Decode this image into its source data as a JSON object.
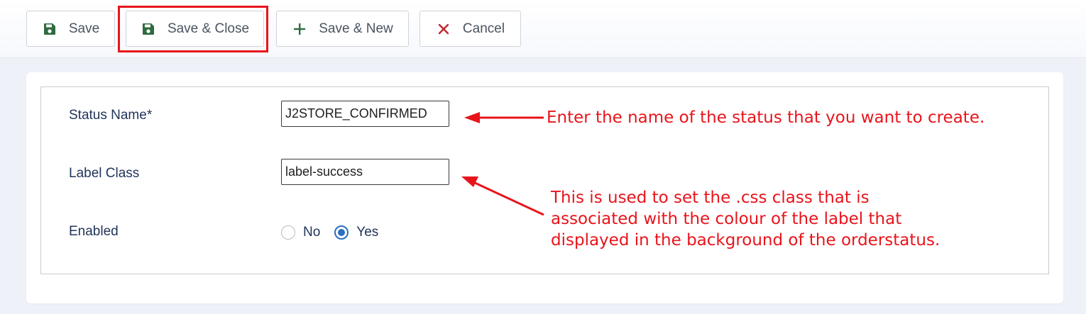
{
  "toolbar": {
    "save_label": "Save",
    "save_close_label": "Save & Close",
    "save_new_label": "Save & New",
    "cancel_label": "Cancel"
  },
  "form": {
    "status_name": {
      "label": "Status Name*",
      "value": "J2STORE_CONFIRMED"
    },
    "label_class": {
      "label": "Label Class",
      "value": "label-success"
    },
    "enabled": {
      "label": "Enabled",
      "options": [
        {
          "label": "No",
          "selected": false
        },
        {
          "label": "Yes",
          "selected": true
        }
      ]
    }
  },
  "annotations": {
    "status_name": "Enter the name of the status that you want to create.",
    "label_class": [
      "This is used to set the .css class that is",
      "associated with the colour of the label that",
      "displayed in the background of the orderstatus."
    ]
  },
  "colors": {
    "annotation": "#e8141c",
    "save_icon": "#2e6b3f",
    "cancel_icon": "#c0262d",
    "radio_accent": "#2a6fc0"
  }
}
